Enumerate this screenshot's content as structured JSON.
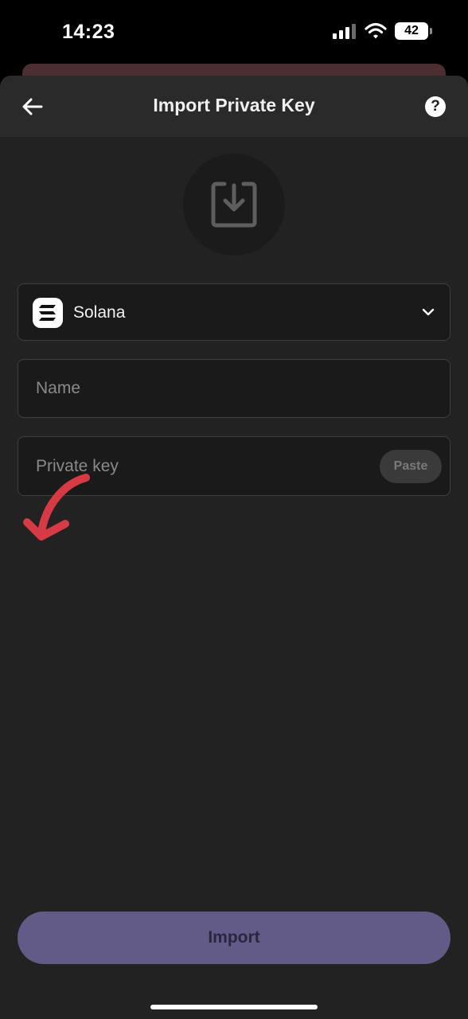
{
  "status_bar": {
    "time": "14:23",
    "battery_level": "42",
    "icons": [
      "cellular-signal-icon",
      "wifi-icon",
      "battery-icon"
    ]
  },
  "header": {
    "title": "Import Private Key",
    "back_icon": "arrow-left-icon",
    "help_icon": "question-circle-icon",
    "help_glyph": "?"
  },
  "hero": {
    "icon": "download-tray-icon"
  },
  "network": {
    "name": "Solana",
    "logo_icon": "solana-logo-icon",
    "dropdown_icon": "chevron-down-icon"
  },
  "name_field": {
    "placeholder": "Name",
    "value": ""
  },
  "key_field": {
    "placeholder": "Private key",
    "value": "",
    "paste_label": "Paste"
  },
  "annotation": {
    "icon": "red-arrow-annotation",
    "color": "#d63a44"
  },
  "footer": {
    "import_label": "Import"
  },
  "colors": {
    "background": "#222222",
    "header": "#2a2a2a",
    "field": "#1a1a1a",
    "accent": "#625a87"
  }
}
